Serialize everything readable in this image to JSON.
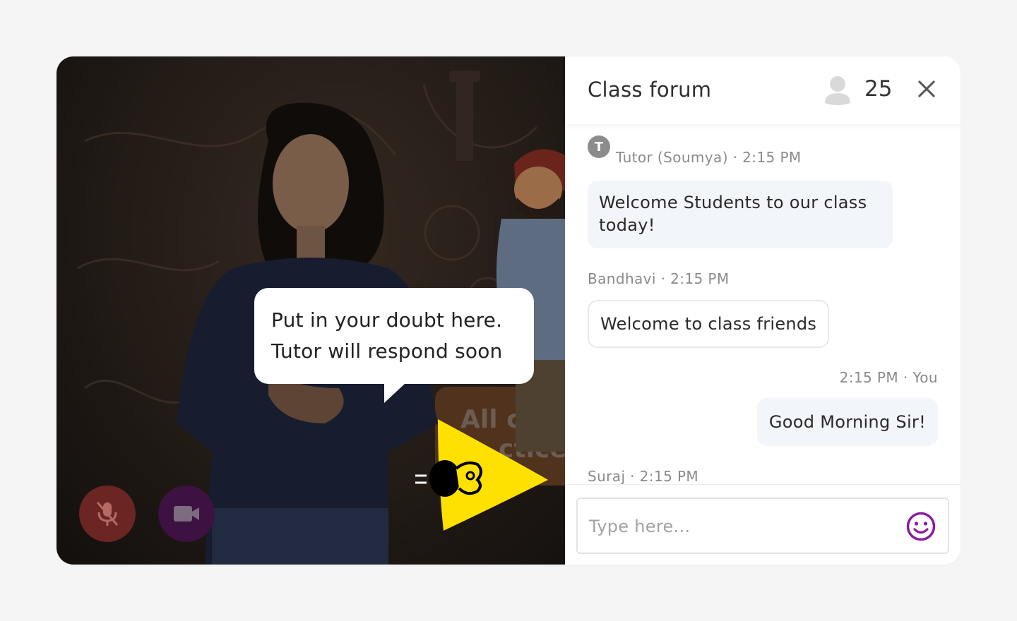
{
  "video": {
    "tooltip_lines": [
      "Put in your doubt here.",
      "Tutor will respond soon"
    ],
    "controls": {
      "mic_icon": "mic-off-icon",
      "camera_icon": "video-camera-icon",
      "mic_color": "#6b2522",
      "camera_color": "#3d1142"
    },
    "pointer_color": "#ffe100"
  },
  "forum": {
    "title": "Class forum",
    "participant_icon": "user-icon",
    "participant_count": "25",
    "close_icon": "close-icon",
    "messages": [
      {
        "avatar_letter": "T",
        "meta": "Tutor (Soumya) · 2:15 PM",
        "text": "Welcome Students to our class today!"
      },
      {
        "meta": "Bandhavi · 2:15 PM",
        "text": "Welcome to class friends"
      },
      {
        "meta": "2:15 PM · You",
        "text": "Good Morning Sir!"
      },
      {
        "meta": "Suraj · 2:15 PM"
      }
    ],
    "input_placeholder": "Type here...",
    "emoji_icon": "smiley-icon",
    "accent_color": "#8a1c9e"
  }
}
